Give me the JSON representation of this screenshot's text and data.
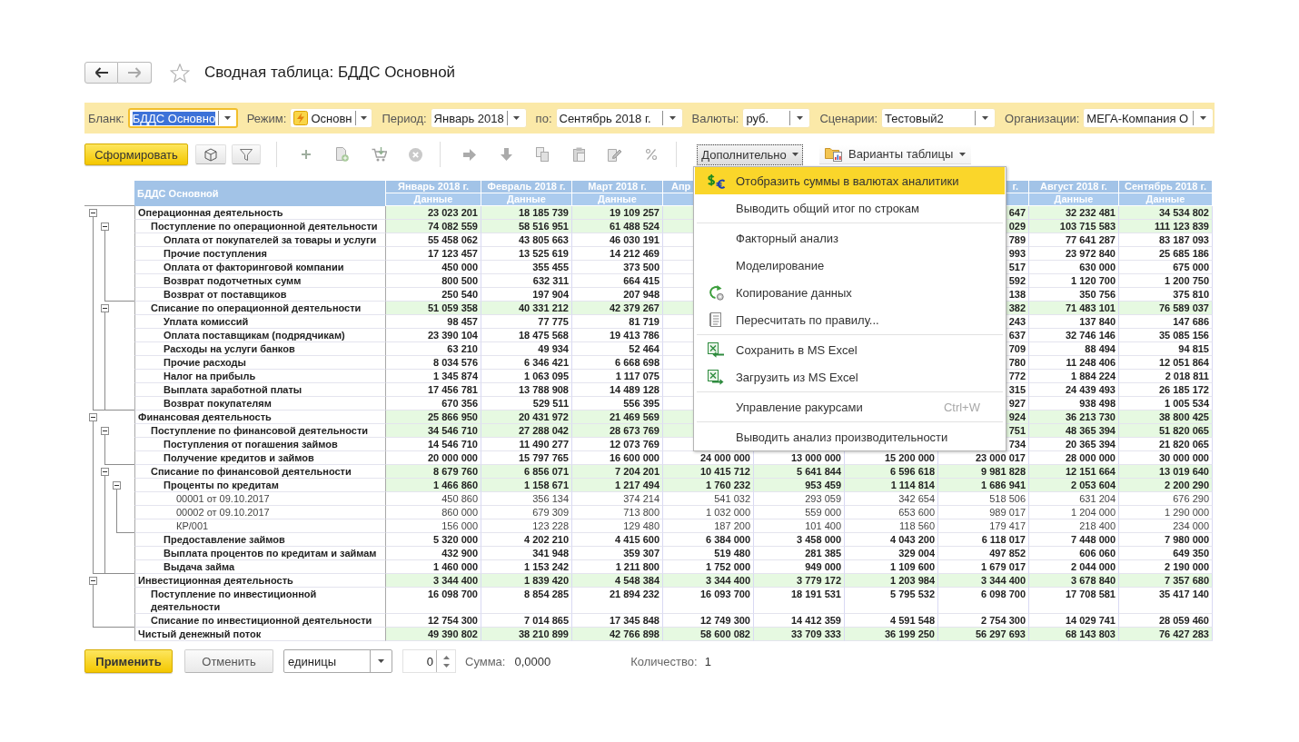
{
  "nav": {
    "back": {
      "disabled": false
    },
    "forward": {
      "disabled": true
    }
  },
  "favorite": false,
  "title": "Сводная таблица: БДДС Основной",
  "filters": [
    {
      "label": "Бланк:",
      "value": "БДДС Основно",
      "focused": true
    },
    {
      "label": "Режим:",
      "value": "Основн",
      "focused": false
    },
    {
      "label": "Период:",
      "value": "Январь 2018",
      "focused": false
    },
    {
      "label": "по:",
      "value": "Сентябрь 2018 г.",
      "focused": false
    },
    {
      "label": "Валюты:",
      "value": "руб.",
      "focused": false
    },
    {
      "label": "Сценарии:",
      "value": "Тестовый2",
      "focused": false
    },
    {
      "label": "Организации:",
      "value": "МЕГА-Компания О",
      "focused": false
    }
  ],
  "toolbar": {
    "generate_button": "Сформировать",
    "more_button": {
      "label": "Дополнительно",
      "open": true
    },
    "variants_button": "Варианты таблицы"
  },
  "more_menu": {
    "sections": [
      {
        "items": [
          {
            "label": "Отобразить суммы в валютах аналитики",
            "selected": true
          },
          {
            "label": "Выводить общий итог по строкам",
            "selected": false
          }
        ]
      },
      {
        "items": [
          {
            "label": "Факторный анализ",
            "selected": false
          },
          {
            "label": "Моделирование",
            "selected": false
          },
          {
            "label": "Копирование данных",
            "selected": false
          },
          {
            "label": "Пересчитать по правилу...",
            "selected": false
          }
        ]
      },
      {
        "items": [
          {
            "label": "Сохранить в MS Excel",
            "selected": false
          },
          {
            "label": "Загрузить из MS Excel",
            "selected": false
          }
        ]
      },
      {
        "items": [
          {
            "label": "Управление ракурсами",
            "shortcut": "Ctrl+W",
            "selected": false
          }
        ]
      },
      {
        "items": [
          {
            "label": "Выводить анализ производительности",
            "selected": false
          }
        ]
      }
    ]
  },
  "table": {
    "corner_title": "БДДС Основной",
    "columns": [
      {
        "period": "Январь 2018 г.",
        "measure": "Данные"
      },
      {
        "period": "Февраль 2018 г.",
        "measure": "Данные"
      },
      {
        "period": "Март 2018 г.",
        "measure": "Данные"
      },
      {
        "period": "Апр"
      },
      {
        "period": "г."
      },
      {
        "period": "Август 2018 г.",
        "measure": "Данные"
      },
      {
        "period": "Сентябрь 2018 г.",
        "measure": "Данные"
      }
    ],
    "rows": [
      {
        "label": "Операционная деятельность",
        "kind": "total",
        "expanded": true,
        "values": [
          "23 023 201",
          "18 185 739",
          "19 109 257",
          "647",
          "32 232 481",
          "34 534 802"
        ],
        "children": [
          {
            "label": "Поступление по операционной деятельности",
            "kind": "total",
            "expanded": true,
            "values": [
              "74 082 559",
              "58 516 951",
              "61 488 524",
              "029",
              "103 715 583",
              "111 123 839"
            ],
            "children": [
              {
                "label": "Оплата от покупателей за товары и услуги",
                "kind": "item",
                "values": [
                  "55 458 062",
                  "43 805 663",
                  "46 030 191",
                  "789",
                  "77 641 287",
                  "83 187 093"
                ]
              },
              {
                "label": "Прочие поступления",
                "kind": "item",
                "values": [
                  "17 123 457",
                  "13 525 619",
                  "14 212 469",
                  "993",
                  "23 972 840",
                  "25 685 186"
                ]
              },
              {
                "label": "Оплата от факторинговой компании",
                "kind": "item",
                "values": [
                  "450 000",
                  "355 455",
                  "373 500",
                  "517",
                  "630 000",
                  "675 000"
                ]
              },
              {
                "label": "Возврат подотчетных сумм",
                "kind": "item",
                "values": [
                  "800 500",
                  "632 311",
                  "664 415",
                  "592",
                  "1 120 700",
                  "1 200 750"
                ]
              },
              {
                "label": "Возврат от поставщиков",
                "kind": "item",
                "values": [
                  "250 540",
                  "197 904",
                  "207 948",
                  "138",
                  "350 756",
                  "375 810"
                ]
              }
            ]
          },
          {
            "label": "Списание по операционной деятельности",
            "kind": "total",
            "expanded": true,
            "values": [
              "51 059 358",
              "40 331 212",
              "42 379 267",
              "382",
              "71 483 101",
              "76 589 037"
            ],
            "children": [
              {
                "label": "Уплата комиссий",
                "kind": "item",
                "values": [
                  "98 457",
                  "77 775",
                  "81 719",
                  "243",
                  "137 840",
                  "147 686"
                ]
              },
              {
                "label": "Оплата поставщикам (подрядчикам)",
                "kind": "item",
                "values": [
                  "23 390 104",
                  "18 475 568",
                  "19 413 786",
                  "637",
                  "32 746 146",
                  "35 085 156"
                ]
              },
              {
                "label": "Расходы на услуги банков",
                "kind": "item",
                "values": [
                  "63 210",
                  "49 934",
                  "52 464",
                  "709",
                  "88 494",
                  "94 815"
                ]
              },
              {
                "label": "Прочие расходы",
                "kind": "item",
                "values": [
                  "8 034 576",
                  "6 346 421",
                  "6 668 698",
                  "780",
                  "11 248 406",
                  "12 051 864"
                ]
              },
              {
                "label": "Налог на прибыль",
                "kind": "item",
                "values": [
                  "1 345 874",
                  "1 063 095",
                  "1 117 075",
                  "772",
                  "1 884 224",
                  "2 018 811"
                ]
              },
              {
                "label": "Выплата заработной платы",
                "kind": "item",
                "values": [
                  "17 456 781",
                  "13 788 908",
                  "14 489 128",
                  "315",
                  "24 439 493",
                  "26 185 172"
                ]
              },
              {
                "label": "Возврат покупателям",
                "kind": "item",
                "values": [
                  "670 356",
                  "529 511",
                  "556 395",
                  "927",
                  "938 498",
                  "1 005 534"
                ]
              }
            ]
          }
        ]
      },
      {
        "label": "Финансовая деятельность",
        "kind": "total",
        "expanded": true,
        "values": [
          "25 866 950",
          "20 431 972",
          "21 469 569",
          "924",
          "36 213 730",
          "38 800 425"
        ],
        "children": [
          {
            "label": "Поступление по финансовой деятельности",
            "kind": "total",
            "expanded": true,
            "values": [
              "34 546 710",
              "27 288 042",
              "28 673 769",
              "751",
              "48 365 394",
              "51 820 065"
            ],
            "children": [
              {
                "label": "Поступления от погашения займов",
                "kind": "item",
                "values": [
                  "14 546 710",
                  "11 490 277",
                  "12 073 769",
                  "734",
                  "20 365 394",
                  "21 820 065"
                ]
              },
              {
                "label": "Получение кредитов и займов",
                "kind": "item",
                "values": [
                  "20 000 000",
                  "15 797 765",
                  "16 600 000",
                  "24 000 000",
                  "13 000 000",
                  "15 200 000",
                  "23 000 017",
                  "28 000 000",
                  "30 000 000"
                ]
              }
            ]
          },
          {
            "label": "Списание по финансовой деятельности",
            "kind": "total",
            "expanded": true,
            "values": [
              "8 679 760",
              "6 856 071",
              "7 204 201",
              "10 415 712",
              "5 641 844",
              "6 596 618",
              "9 981 828",
              "12 151 664",
              "13 019 640"
            ],
            "children": [
              {
                "label": "Проценты по кредитам",
                "kind": "total",
                "expanded": true,
                "values": [
                  "1 466 860",
                  "1 158 671",
                  "1 217 494",
                  "1 760 232",
                  "953 459",
                  "1 114 814",
                  "1 686 941",
                  "2 053 604",
                  "2 200 290"
                ],
                "children": [
                  {
                    "label": "00001 от 09.10.2017",
                    "kind": "detail",
                    "values": [
                      "450 860",
                      "356 134",
                      "374 214",
                      "541 032",
                      "293 059",
                      "342 654",
                      "518 506",
                      "631 204",
                      "676 290"
                    ]
                  },
                  {
                    "label": "00002 от 09.10.2017",
                    "kind": "detail",
                    "values": [
                      "860 000",
                      "679 309",
                      "713 800",
                      "1 032 000",
                      "559 000",
                      "653 600",
                      "989 017",
                      "1 204 000",
                      "1 290 000"
                    ]
                  },
                  {
                    "label": "КР/001",
                    "kind": "detail",
                    "values": [
                      "156 000",
                      "123 228",
                      "129 480",
                      "187 200",
                      "101 400",
                      "118 560",
                      "179 417",
                      "218 400",
                      "234 000"
                    ]
                  }
                ]
              },
              {
                "label": "Предоставление займов",
                "kind": "item",
                "values": [
                  "5 320 000",
                  "4 202 210",
                  "4 415 600",
                  "6 384 000",
                  "3 458 000",
                  "4 043 200",
                  "6 118 017",
                  "7 448 000",
                  "7 980 000"
                ]
              },
              {
                "label": "Выплата процентов по кредитам и займам",
                "kind": "item",
                "values": [
                  "432 900",
                  "341 948",
                  "359 307",
                  "519 480",
                  "281 385",
                  "329 004",
                  "497 852",
                  "606 060",
                  "649 350"
                ]
              },
              {
                "label": "Выдача займа",
                "kind": "item",
                "values": [
                  "1 460 000",
                  "1 153 242",
                  "1 211 800",
                  "1 752 000",
                  "949 000",
                  "1 109 600",
                  "1 679 017",
                  "2 044 000",
                  "2 190 000"
                ]
              }
            ]
          }
        ]
      },
      {
        "label": "Инвестиционная деятельность",
        "kind": "total",
        "expanded": true,
        "values": [
          "3 344 400",
          "1 839 420",
          "4 548 384",
          "3 344 400",
          "3 779 172",
          "1 203 984",
          "3 344 400",
          "3 678 840",
          "7 357 680"
        ],
        "children": [
          {
            "label": "Поступление по инвестиционной деятельности",
            "kind": "item",
            "values": [
              "16 098 700",
              "8 854 285",
              "21 894 232",
              "16 093 700",
              "18 191 531",
              "5 795 532",
              "6 098 700",
              "17 708 581",
              "35 417 140"
            ]
          },
          {
            "label": "Списание по инвестиционной деятельности",
            "kind": "item",
            "values": [
              "12 754 300",
              "7 014 865",
              "17 345 848",
              "12 749 300",
              "14 412 359",
              "4 591 548",
              "2 754 300",
              "14 029 741",
              "28 059 460"
            ]
          }
        ]
      },
      {
        "label": "Чистый денежный поток",
        "kind": "total",
        "values": [
          "49 390 802",
          "38 210 899",
          "42 766 898",
          "58 600 082",
          "33 709 333",
          "36 199 250",
          "56 297 693",
          "68 143 803",
          "76 427 283"
        ]
      }
    ]
  },
  "footer": {
    "apply_button": "Применить",
    "cancel_button": "Отменить",
    "units_field": "единицы",
    "precision_field": "0",
    "sum_label": "Сумма:",
    "sum_value": "0,0000",
    "count_label": "Количество:",
    "count_value": "1"
  }
}
